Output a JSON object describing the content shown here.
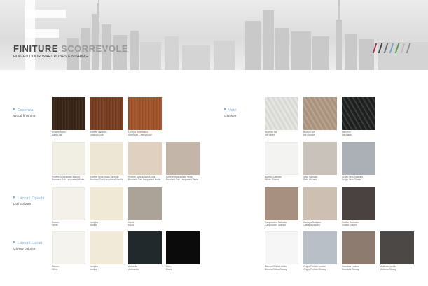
{
  "header": {
    "title_part1": "FINITURE",
    "title_part2": "SCORREVOLE",
    "subtitle": "HINGED DOOR WARDROBES FINISHING",
    "stripe_colors": [
      "#a3324b",
      "#444444",
      "#6e6e6e",
      "#7aa4c8",
      "#5f9a54",
      "#bcbcbc",
      "#8f8f8f"
    ]
  },
  "sections": {
    "essenza": {
      "it": "Essenza",
      "en": "Wood finishing"
    },
    "vetri": {
      "it": "Vetri",
      "en": "Glasses"
    },
    "laccati_opachi": {
      "it": "Laccati Opachi",
      "en": "Dull colours"
    },
    "laccati_lucidi": {
      "it": "Laccati Lucidi",
      "en": "Glossy colours"
    }
  },
  "swatches_left": [
    {
      "it": "Rovere Moro",
      "en": "Dark Oak",
      "color": "#3a2619"
    },
    {
      "it": "Rovere Tabacco",
      "en": "Tobacco Oak",
      "color": "#7a3f22"
    },
    {
      "it": "Ciliegio Americano",
      "en": "American Cherrywood",
      "color": "#a4562c"
    },
    {
      "it": "Rovere Spazzolato Bianco",
      "en": "Brushed Oak Lacquered White",
      "color": "#f1eee4"
    },
    {
      "it": "Rovere Spazzolato Vaniglia",
      "en": "Brushed Oak Lacquered Vanilla",
      "color": "#eee6d4"
    },
    {
      "it": "Rovere Spazzolato Kodia",
      "en": "Brushed Oak Lacquered Kodia",
      "color": "#e0d0bf"
    },
    {
      "it": "Rovere Spazzolato Perla",
      "en": "Brushed Oak Lacquered Perla",
      "color": "#c3b5a8"
    },
    {
      "it": "Bianco",
      "en": "White",
      "color": "#f3f1e9"
    },
    {
      "it": "Vaniglia",
      "en": "Vanilla",
      "color": "#efe9d6"
    },
    {
      "it": "Kodia",
      "en": "Kodia",
      "color": "#aca398"
    },
    {
      "it": "Bianco",
      "en": "White",
      "color": "#f4f3ee"
    },
    {
      "it": "Vaniglia",
      "en": "Vanilla",
      "color": "#f1ead8"
    },
    {
      "it": "Antracite",
      "en": "Anthracite",
      "color": "#22292c"
    },
    {
      "it": "Nero",
      "en": "Black",
      "color": "#0b0b0b"
    }
  ],
  "swatches_right": [
    {
      "it": "Argento Ice",
      "en": "Ice Silver",
      "color": "#e6e6e2"
    },
    {
      "it": "Bronzo Ice",
      "en": "Ice Bronze",
      "color": "#b39a85"
    },
    {
      "it": "Nero Ice",
      "en": "Ice Black",
      "color": "#1f2120"
    },
    {
      "it": "Bianco Satinato",
      "en": "White Glazed",
      "color": "#f3f3f1"
    },
    {
      "it": "Seta Satinato",
      "en": "Seta Glazed",
      "color": "#c8c2bb"
    },
    {
      "it": "Grigio Velo Satinato",
      "en": "Grigio Velo Glazed",
      "color": "#aab0b6"
    },
    {
      "it": "Cappuccino Satinato",
      "en": "Cappuccino Glazed",
      "color": "#a89080"
    },
    {
      "it": "Canapa Satinato",
      "en": "Canapa Glazed",
      "color": "#cdbfb1"
    },
    {
      "it": "Grafite Satinato",
      "en": "Grafite Glazed",
      "color": "#4a4240"
    },
    {
      "it": "Bianco Ottico Lucido",
      "en": "Bianco Ottico Glossy",
      "color": "#f6f6f6"
    },
    {
      "it": "Grigio Perlato Lucido",
      "en": "Grigio Perlato Glossy",
      "color": "#b9bfc6"
    },
    {
      "it": "Nocciola Lucido",
      "en": "Nocciola Glossy",
      "color": "#8d7b70"
    },
    {
      "it": "Ardesia Lucido",
      "en": "Ardesia Glossy",
      "color": "#4b4846"
    }
  ]
}
